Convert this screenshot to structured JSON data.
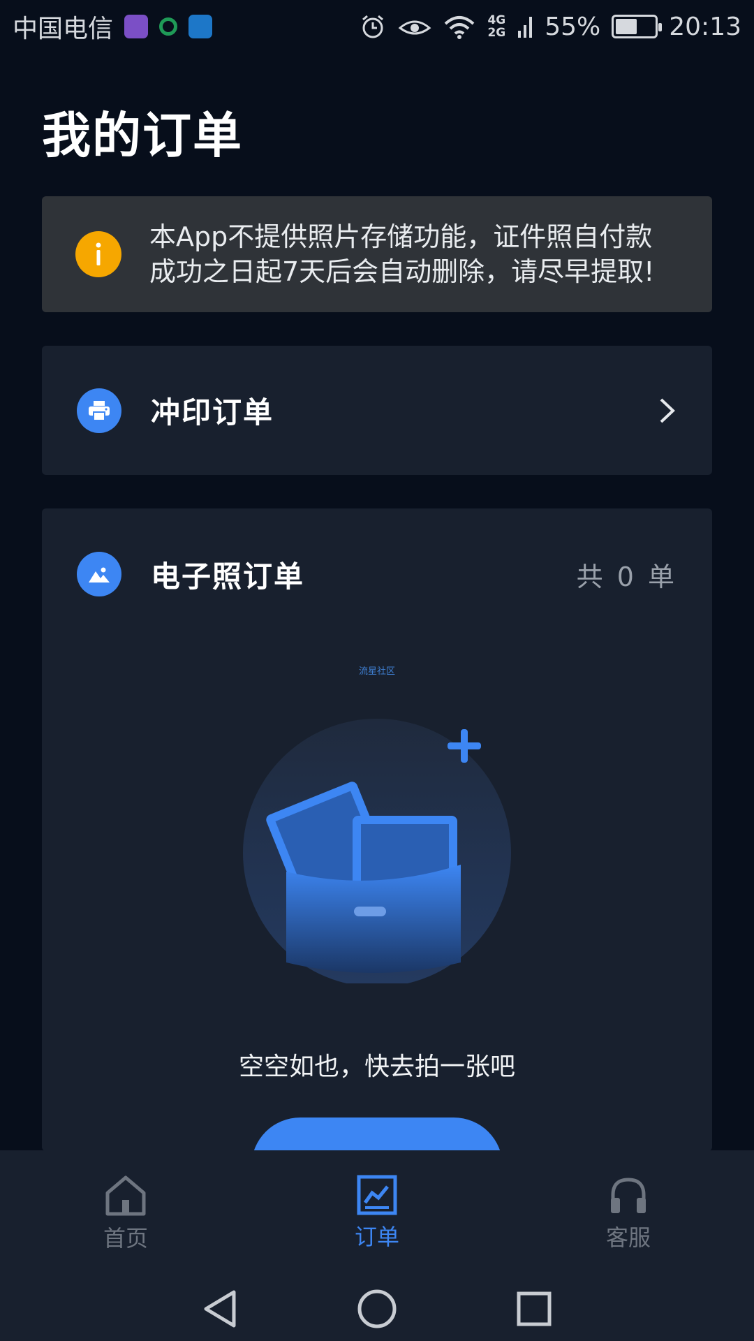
{
  "status_bar": {
    "carrier": "中国电信",
    "network_top": "4G",
    "network_bottom": "2G",
    "battery_percent": "55%",
    "battery_level": 0.55,
    "time": "20:13"
  },
  "page_title": "我的订单",
  "notice": {
    "icon": "info-icon",
    "text": "本App不提供照片存储功能，证件照自付款成功之日起7天后会自动删除，请尽早提取!"
  },
  "print_orders": {
    "label": "冲印订单",
    "icon": "printer-icon"
  },
  "photo_orders": {
    "label": "电子照订单",
    "icon": "image-icon",
    "count_text": "共 0 单",
    "watermark": "流星社区",
    "empty_text": "空空如也，快去拍一张吧"
  },
  "bottom_nav": {
    "items": [
      {
        "label": "首页",
        "icon": "home-icon",
        "active": false
      },
      {
        "label": "订单",
        "icon": "chart-icon",
        "active": true
      },
      {
        "label": "客服",
        "icon": "headset-icon",
        "active": false
      }
    ]
  },
  "colors": {
    "background": "#070e1b",
    "card": "#18202e",
    "accent": "#3d86f3",
    "warning": "#f6a700"
  }
}
